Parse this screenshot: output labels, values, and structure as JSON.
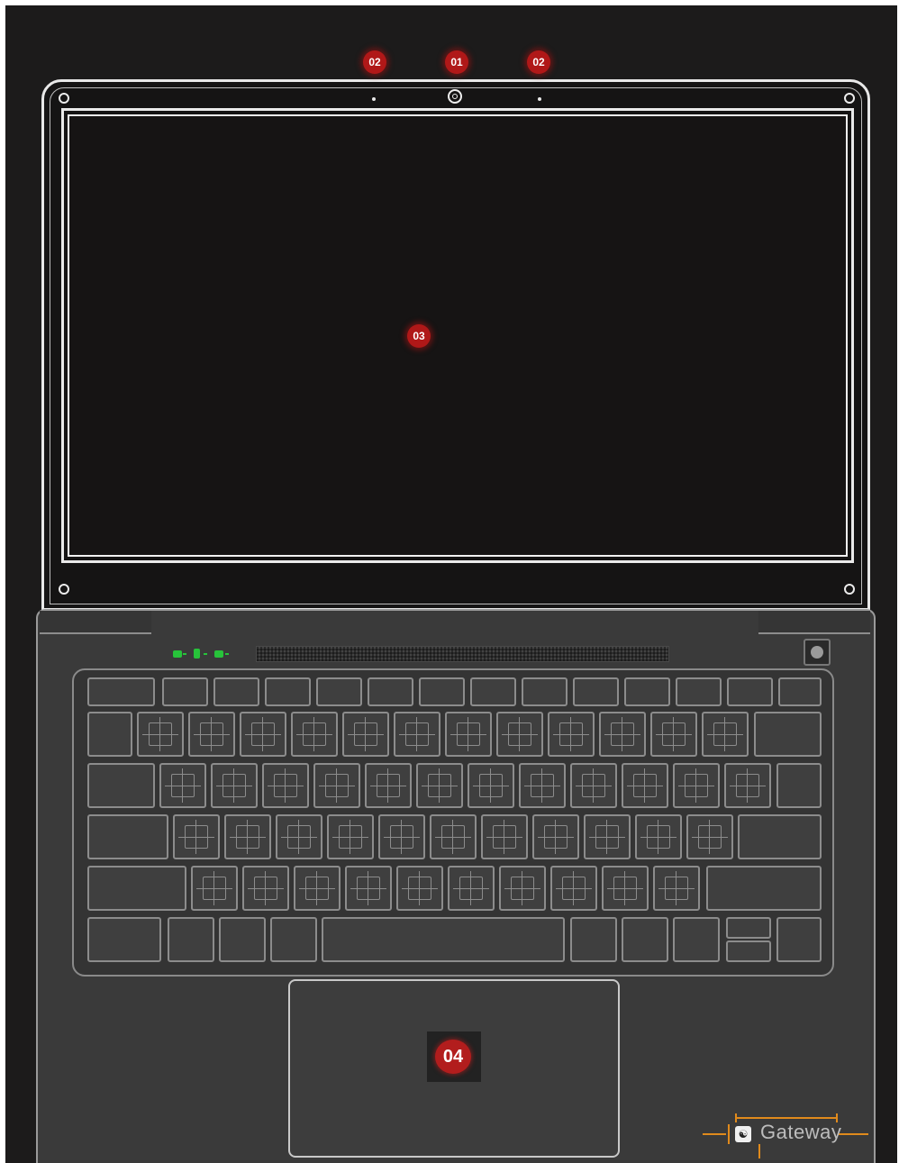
{
  "callouts": {
    "webcam": "01",
    "mic_left": "02",
    "mic_right": "02",
    "display": "03",
    "touchpad": "04"
  },
  "brand": {
    "logo_text": "Gateway"
  },
  "colors": {
    "background": "#1c1b1b",
    "outline": "#e8e8e8",
    "marker": "#b01818",
    "status_led": "#27c33a",
    "dimension_lines": "#e08a1c"
  },
  "icons": {
    "webcam": "camera-icon",
    "microphone": "mic-icon",
    "power": "power-icon",
    "status": [
      "power-status-icon",
      "battery-status-icon",
      "hdd-status-icon"
    ],
    "logo": "gateway-logo-icon"
  }
}
